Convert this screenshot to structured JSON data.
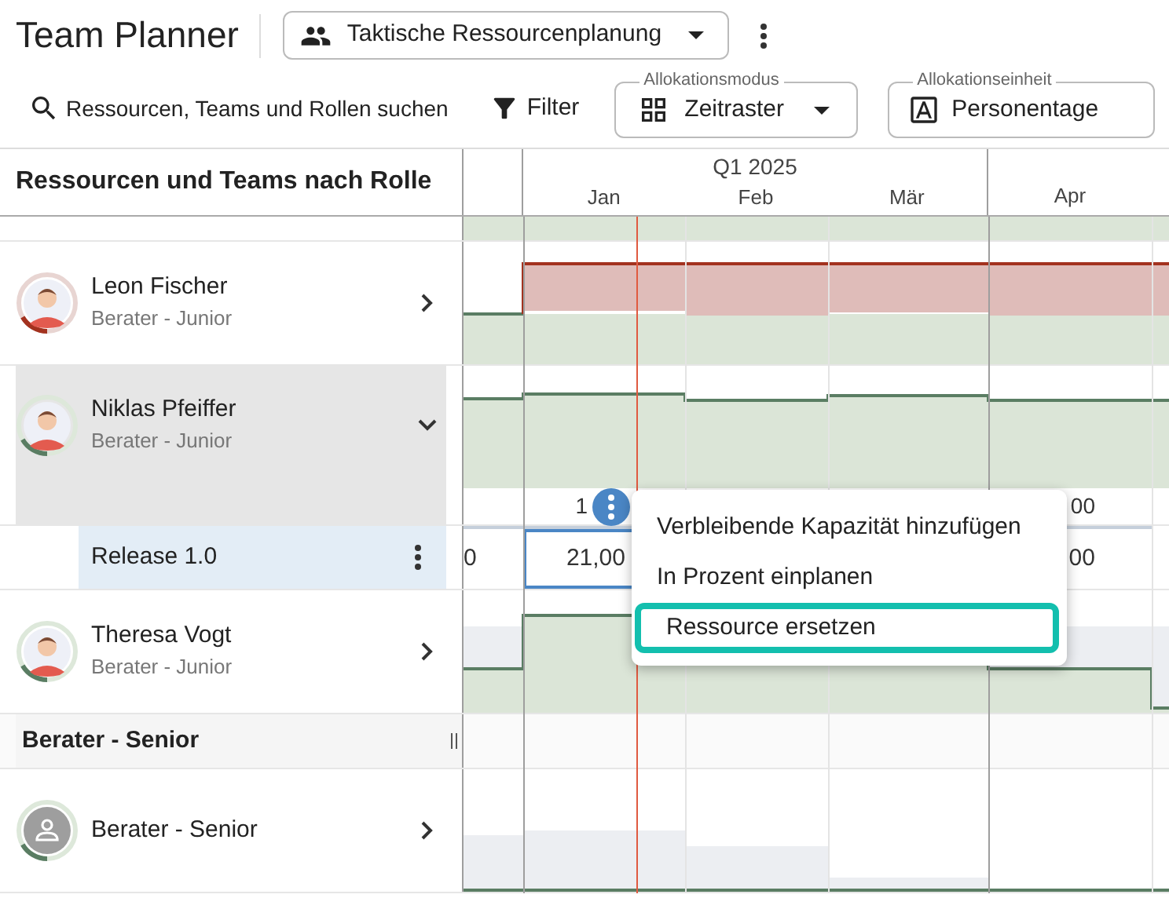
{
  "header": {
    "title": "Team Planner",
    "view_button": "Taktische Ressourcenplanung"
  },
  "toolbar": {
    "search": "Ressourcen, Teams und Rollen suchen",
    "filter": "Filter",
    "mode": {
      "label": "Allokationsmodus",
      "value": "Zeitraster"
    },
    "unit": {
      "label": "Allokationseinheit",
      "value": "Personentage"
    }
  },
  "side_title": "Ressourcen und Teams nach Rolle",
  "timeline": {
    "quarter": "Q1 2025",
    "months": [
      "Jan",
      "Feb",
      "Mär",
      "Apr"
    ]
  },
  "rows": [
    {
      "kind": "resource",
      "name": "Leon Fischer",
      "role": "Berater - Junior",
      "avatar": {
        "kind": "photo"
      },
      "color": "#a3321f",
      "expanded": false,
      "selected": false,
      "chart": {
        "kind": "over"
      }
    },
    {
      "kind": "resource",
      "name": "Niklas Pfeiffer",
      "role": "Berater - Junior",
      "avatar": {
        "kind": "photo"
      },
      "color": "#5a7d63",
      "expanded": true,
      "selected": true,
      "chart": {
        "kind": "full"
      },
      "totals": {
        "jan": "1",
        "apr": "00"
      }
    },
    {
      "kind": "assignment",
      "name": "Release 1.0",
      "values": {
        "previous": "0",
        "jan": "21,00",
        "apr": ",00"
      },
      "jan_focused": true
    },
    {
      "kind": "resource",
      "name": "Theresa Vogt",
      "role": "Berater - Junior",
      "avatar": {
        "kind": "photo"
      },
      "color": "#5a7d63",
      "expanded": false,
      "selected": false,
      "chart": {
        "kind": "partial"
      }
    },
    {
      "kind": "group",
      "name": "Berater - Senior"
    },
    {
      "kind": "resource",
      "name": "Berater - Senior",
      "avatar": {
        "kind": "placeholder"
      },
      "color": "#5a7d63",
      "expanded": false,
      "selected": false,
      "chart": {
        "kind": "low"
      }
    }
  ],
  "menu": {
    "items": [
      {
        "label": "Verbleibende Kapazität hinzufügen",
        "focused": false
      },
      {
        "label": "In Prozent einplanen",
        "focused": false
      },
      {
        "label": "Ressource ersetzen",
        "focused": true
      }
    ]
  }
}
